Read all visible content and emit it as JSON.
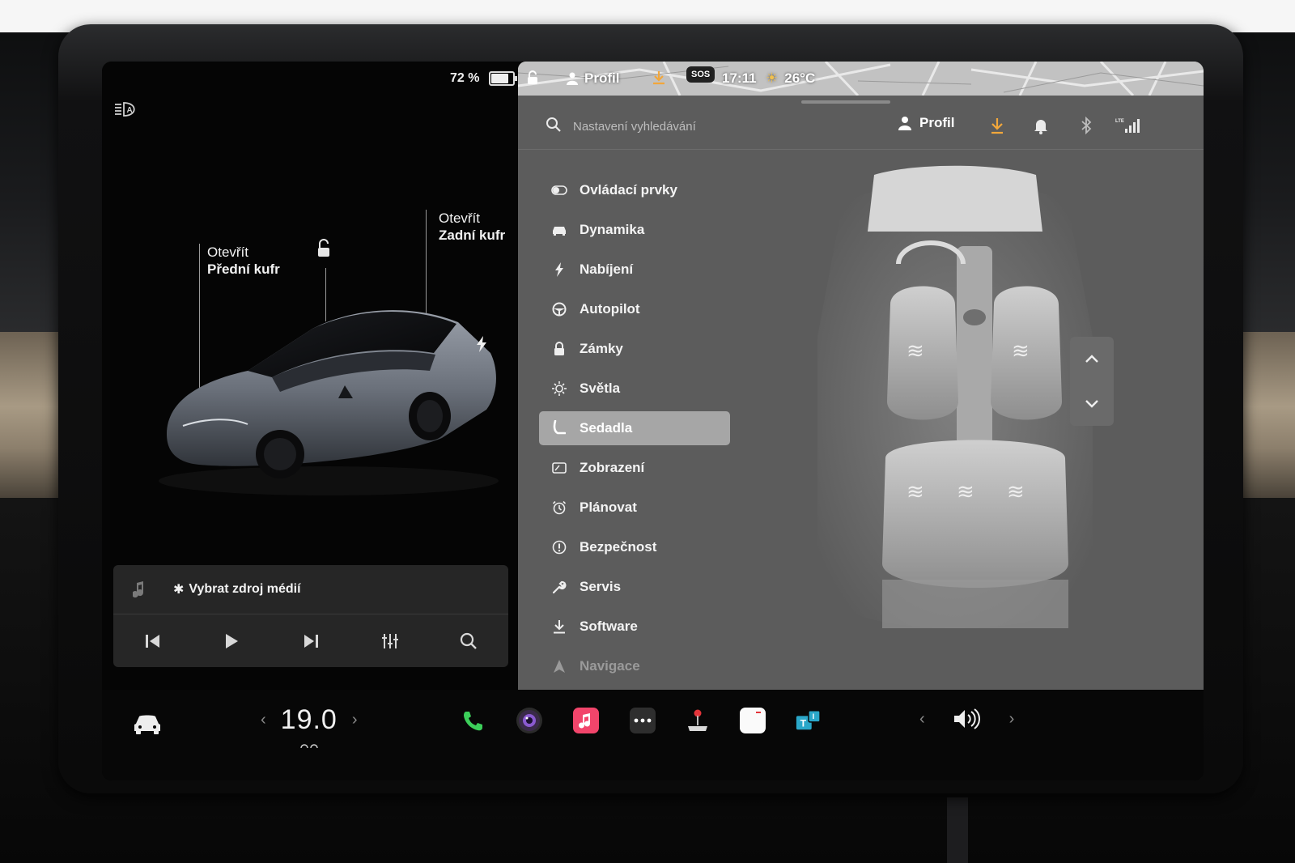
{
  "status": {
    "battery_percent": "72 %",
    "battery_level": 0.72,
    "profile_label": "Profil",
    "time": "17:11",
    "temperature": "26°C",
    "sos_label": "SOS"
  },
  "car": {
    "frunk_line1": "Otevřít",
    "frunk_line2": "Přední kufr",
    "trunk_line1": "Otevřít",
    "trunk_line2": "Zadní kufr"
  },
  "media": {
    "source_label": "Vybrat zdroj médií",
    "controls": [
      "previous-track",
      "play",
      "next-track",
      "equalizer",
      "search"
    ]
  },
  "settings": {
    "search_placeholder": "Nastavení vyhledávání",
    "profile_label": "Profil",
    "menu": [
      {
        "label": "Ovládací prvky",
        "icon": "toggle-icon"
      },
      {
        "label": "Dynamika",
        "icon": "car-icon"
      },
      {
        "label": "Nabíjení",
        "icon": "lightning-icon"
      },
      {
        "label": "Autopilot",
        "icon": "steering-wheel-icon"
      },
      {
        "label": "Zámky",
        "icon": "lock-icon"
      },
      {
        "label": "Světla",
        "icon": "sun-icon"
      },
      {
        "label": "Sedadla",
        "icon": "seat-icon"
      },
      {
        "label": "Zobrazení",
        "icon": "display-icon"
      },
      {
        "label": "Plánovat",
        "icon": "alarm-clock-icon"
      },
      {
        "label": "Bezpečnost",
        "icon": "alert-circle-icon"
      },
      {
        "label": "Servis",
        "icon": "wrench-icon"
      },
      {
        "label": "Software",
        "icon": "download-icon"
      },
      {
        "label": "Navigace",
        "icon": "navigation-icon"
      }
    ],
    "active_index": 6
  },
  "dock": {
    "temperature": "19.0",
    "apps": [
      "phone-icon",
      "camera-icon",
      "music-icon",
      "more-icon",
      "joystick-icon",
      "calendar-icon",
      "toybox-icon"
    ]
  },
  "colors": {
    "accent_orange": "#f2a73b",
    "menu_active": "#a6a6a6",
    "panel_gray": "#5c5c5c",
    "music_pink": "#f2456b",
    "phone_green": "#3ccf5a"
  }
}
